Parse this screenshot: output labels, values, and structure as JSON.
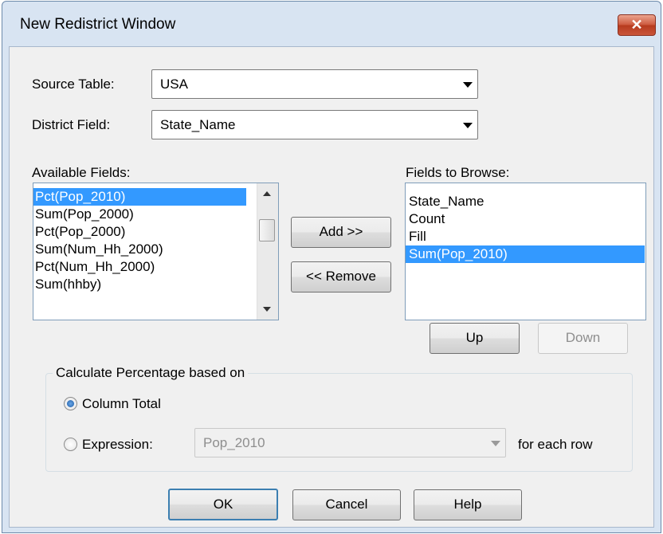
{
  "window": {
    "title": "New Redistrict Window",
    "close_glyph": "✕"
  },
  "source_table": {
    "label": "Source Table:",
    "value": "USA"
  },
  "district_field": {
    "label": "District Field:",
    "value": "State_Name"
  },
  "available_fields": {
    "label": "Available Fields:",
    "items": [
      "Pct(Pop_2010)",
      "Sum(Pop_2000)",
      "Pct(Pop_2000)",
      "Sum(Num_Hh_2000)",
      "Pct(Num_Hh_2000)",
      "Sum(hhby)"
    ],
    "selected": "Pct(Pop_2010)"
  },
  "fields_to_browse": {
    "label": "Fields to Browse:",
    "items": [
      "State_Name",
      "Count",
      "Fill",
      "Sum(Pop_2010)"
    ],
    "selected": "Sum(Pop_2010)"
  },
  "buttons": {
    "add": "Add >>",
    "remove": "<< Remove",
    "up": "Up",
    "down": "Down",
    "ok": "OK",
    "cancel": "Cancel",
    "help": "Help"
  },
  "percentage": {
    "group_title": "Calculate Percentage based on",
    "column_total": "Column Total",
    "expression": "Expression:",
    "expression_value": "Pop_2010",
    "for_each_row": "for each row",
    "selected_option": "Column Total"
  },
  "colors": {
    "selection": "#3399ff",
    "client_bg": "#f0f0f0",
    "frame": "#d8e4f2",
    "close_button": "#c9553a"
  }
}
